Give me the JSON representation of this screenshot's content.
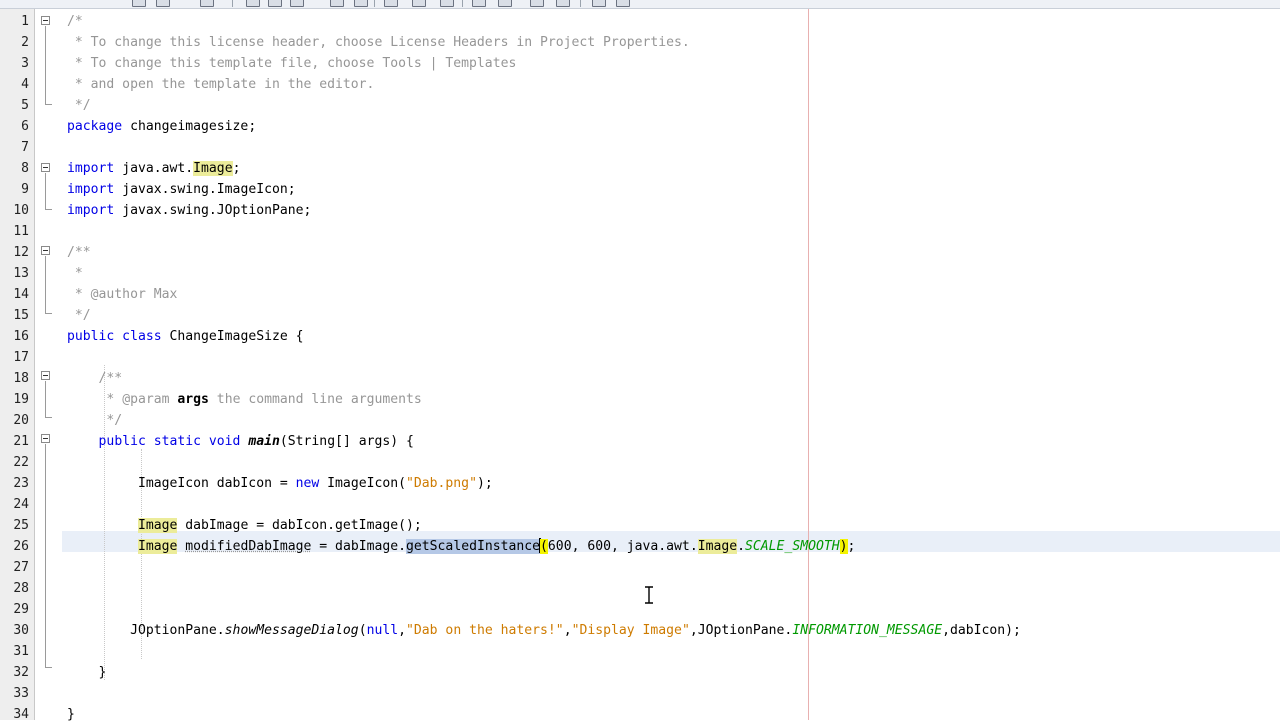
{
  "editor": {
    "current_line": 26,
    "lines": [
      {
        "n": "1",
        "s": [
          {
            "t": "/*",
            "c": "cm"
          }
        ]
      },
      {
        "n": "2",
        "s": [
          {
            "t": " * To change this license header, choose License Headers in Project Properties.",
            "c": "cm"
          }
        ]
      },
      {
        "n": "3",
        "s": [
          {
            "t": " * To change this template file, choose Tools | Templates",
            "c": "cm"
          }
        ]
      },
      {
        "n": "4",
        "s": [
          {
            "t": " * and open the template in the editor.",
            "c": "cm"
          }
        ]
      },
      {
        "n": "5",
        "s": [
          {
            "t": " */",
            "c": "cm"
          }
        ]
      },
      {
        "n": "6",
        "s": [
          {
            "t": "package",
            "c": "kw"
          },
          {
            "t": " changeimagesize;"
          }
        ]
      },
      {
        "n": "7",
        "s": []
      },
      {
        "n": "8",
        "s": [
          {
            "t": "import",
            "c": "kw"
          },
          {
            "t": " java.awt."
          },
          {
            "t": "Image",
            "c": "hl"
          },
          {
            "t": ";"
          }
        ]
      },
      {
        "n": "9",
        "s": [
          {
            "t": "import",
            "c": "kw"
          },
          {
            "t": " javax.swing.ImageIcon;"
          }
        ]
      },
      {
        "n": "10",
        "s": [
          {
            "t": "import",
            "c": "kw"
          },
          {
            "t": " javax.swing.JOptionPane;"
          }
        ]
      },
      {
        "n": "11",
        "s": []
      },
      {
        "n": "12",
        "s": [
          {
            "t": "/**",
            "c": "cm"
          }
        ]
      },
      {
        "n": "13",
        "s": [
          {
            "t": " *",
            "c": "cm"
          }
        ]
      },
      {
        "n": "14",
        "s": [
          {
            "t": " * @author Max",
            "c": "cm"
          }
        ]
      },
      {
        "n": "15",
        "s": [
          {
            "t": " */",
            "c": "cm"
          }
        ]
      },
      {
        "n": "16",
        "s": [
          {
            "t": "public class",
            "c": "kw"
          },
          {
            "t": " ChangeImageSize {"
          }
        ]
      },
      {
        "n": "17",
        "s": []
      },
      {
        "n": "18",
        "s": [
          {
            "t": "    /**",
            "c": "cm"
          }
        ]
      },
      {
        "n": "19",
        "s": [
          {
            "t": "     * ",
            "c": "cm"
          },
          {
            "t": "@param",
            "c": "cm"
          },
          {
            "t": " args",
            "c": "bo"
          },
          {
            "t": " the command line arguments",
            "c": "cm"
          }
        ]
      },
      {
        "n": "20",
        "s": [
          {
            "t": "     */",
            "c": "cm"
          }
        ]
      },
      {
        "n": "21",
        "s": [
          {
            "t": "    "
          },
          {
            "t": "public static void",
            "c": "kw"
          },
          {
            "t": " "
          },
          {
            "t": "main",
            "c": "bo it"
          },
          {
            "t": "(String[] args) {"
          }
        ]
      },
      {
        "n": "22",
        "s": []
      },
      {
        "n": "23",
        "s": [
          {
            "t": "         ImageIcon dabIcon = "
          },
          {
            "t": "new",
            "c": "kw"
          },
          {
            "t": " ImageIcon("
          },
          {
            "t": "\"Dab.png\"",
            "c": "str"
          },
          {
            "t": ");"
          }
        ]
      },
      {
        "n": "24",
        "s": []
      },
      {
        "n": "25",
        "s": [
          {
            "t": "         "
          },
          {
            "t": "Image",
            "c": "hl"
          },
          {
            "t": " dabImage = dabIcon.getImage();"
          }
        ]
      },
      {
        "n": "26",
        "s": [
          {
            "t": "         "
          },
          {
            "t": "Image",
            "c": "hl"
          },
          {
            "t": " "
          },
          {
            "t": "modifiedDabImage",
            "c": "ul"
          },
          {
            "t": " = dabImage."
          },
          {
            "t": "getScaledInstance",
            "c": "sel"
          },
          {
            "t": "",
            "c": "caret"
          },
          {
            "t": "(",
            "c": "bm"
          },
          {
            "t": "600, 600, java.awt."
          },
          {
            "t": "Image",
            "c": "hl"
          },
          {
            "t": "."
          },
          {
            "t": "SCALE_SMOOTH",
            "c": "st"
          },
          {
            "t": ")",
            "c": "bm"
          },
          {
            "t": ";"
          }
        ]
      },
      {
        "n": "27",
        "s": []
      },
      {
        "n": "28",
        "s": []
      },
      {
        "n": "29",
        "s": []
      },
      {
        "n": "30",
        "s": [
          {
            "t": "        JOptionPane."
          },
          {
            "t": "showMessageDialog",
            "c": "it"
          },
          {
            "t": "("
          },
          {
            "t": "null",
            "c": "kw"
          },
          {
            "t": ","
          },
          {
            "t": "\"Dab on the haters!\"",
            "c": "str"
          },
          {
            "t": ","
          },
          {
            "t": "\"Display Image\"",
            "c": "str"
          },
          {
            "t": ",JOptionPane."
          },
          {
            "t": "INFORMATION_MESSAGE",
            "c": "st"
          },
          {
            "t": ",dabIcon);"
          }
        ]
      },
      {
        "n": "31",
        "s": []
      },
      {
        "n": "32",
        "s": [
          {
            "t": "    }"
          }
        ]
      },
      {
        "n": "33",
        "s": []
      },
      {
        "n": "34",
        "s": [
          {
            "t": "}"
          }
        ]
      }
    ]
  }
}
